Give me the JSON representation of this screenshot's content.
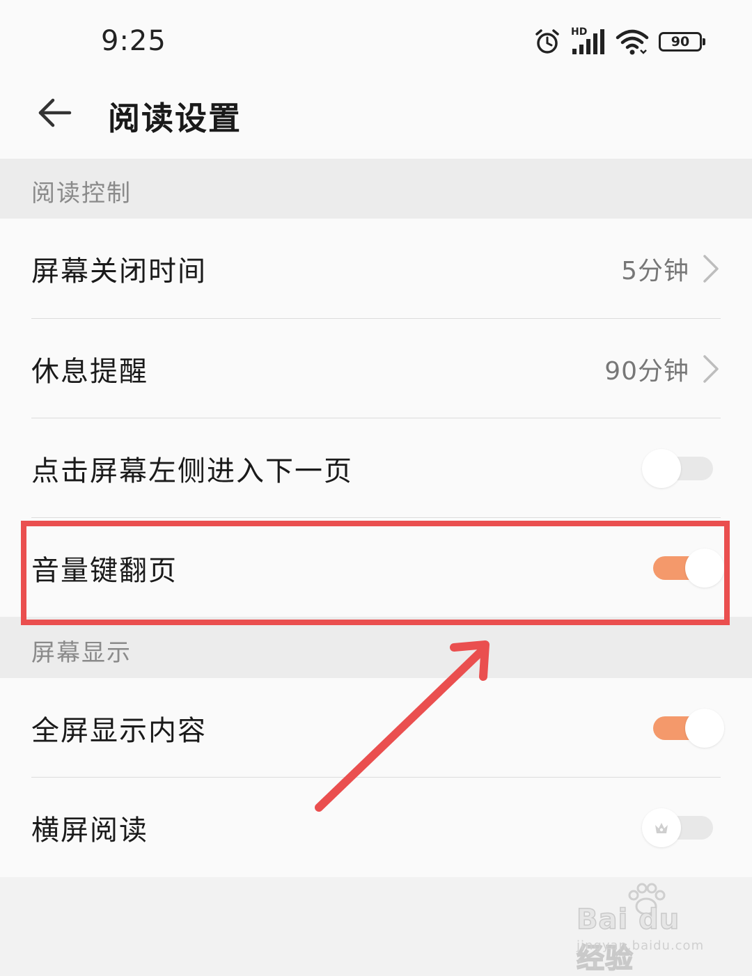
{
  "status_bar": {
    "time": "9:25",
    "network_label": "HD",
    "battery_level": "90",
    "icons": [
      "alarm-icon",
      "signal-icon",
      "wifi-icon",
      "battery-icon"
    ]
  },
  "header": {
    "back_icon": "arrow-left-icon",
    "title": "阅读设置"
  },
  "sections": {
    "reading_control": {
      "title": "阅读控制",
      "items": [
        {
          "label": "屏幕关闭时间",
          "value": "5分钟",
          "type": "link"
        },
        {
          "label": "休息提醒",
          "value": "90分钟",
          "type": "link"
        },
        {
          "label": "点击屏幕左侧进入下一页",
          "type": "toggle",
          "state": "off"
        },
        {
          "label": "音量键翻页",
          "type": "toggle",
          "state": "on"
        }
      ]
    },
    "screen_display": {
      "title": "屏幕显示",
      "items": [
        {
          "label": "全屏显示内容",
          "type": "toggle",
          "state": "on"
        },
        {
          "label": "横屏阅读",
          "type": "toggle",
          "state": "off",
          "knob_icon": "crown-icon"
        }
      ]
    }
  },
  "annotation": {
    "highlight_color": "#ea4f4f",
    "highlight_target": "音量键翻页",
    "arrow": "arrow pointing up-right toward highlighted row"
  },
  "watermark": {
    "brand": "Bai du 经验",
    "url": "jingyan.baidu.com"
  },
  "colors": {
    "accent_toggle_on": "#f4996b",
    "toggle_off_track": "#e8e8e8",
    "page_background": "#f2f2f2",
    "row_background": "#fafafa",
    "section_text": "#8a8a8a"
  }
}
